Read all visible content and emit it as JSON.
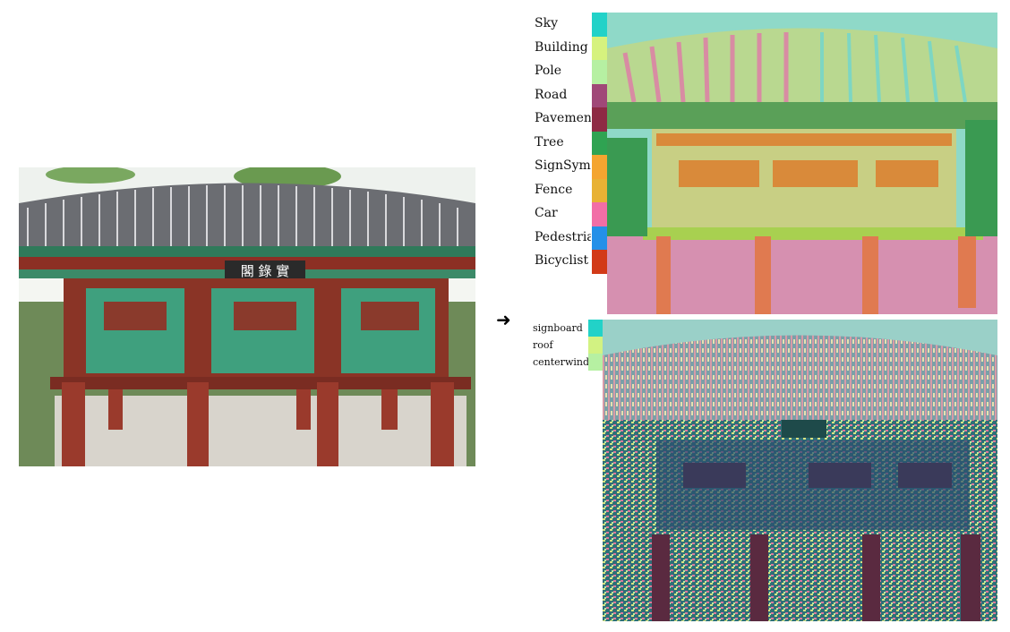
{
  "arrow": {
    "glyph": "➜",
    "icon": "arrow-right-icon"
  },
  "legend_top": [
    {
      "label": "Sky",
      "color": "#22d2c8"
    },
    {
      "label": "Building",
      "color": "#d6f27e"
    },
    {
      "label": "Pole",
      "color": "#b6f0a2"
    },
    {
      "label": "Road",
      "color": "#a04878"
    },
    {
      "label": "Pavement",
      "color": "#8e2a44"
    },
    {
      "label": "Tree",
      "color": "#2fa352"
    },
    {
      "label": "SignSymbol",
      "color": "#f4a530"
    },
    {
      "label": "Fence",
      "color": "#e8b234"
    },
    {
      "label": "Car",
      "color": "#f26ea6"
    },
    {
      "label": "Pedestrian",
      "color": "#2490e8"
    },
    {
      "label": "Bicyclist",
      "color": "#d23a18"
    }
  ],
  "legend_bottom": [
    {
      "label": "signboard",
      "color": "#22d2c8"
    },
    {
      "label": "roof",
      "color": "#d2f282"
    },
    {
      "label": "centerwind",
      "color": "#b6f0a2"
    }
  ],
  "photo": {
    "sign_text": "閣 錄 實"
  }
}
